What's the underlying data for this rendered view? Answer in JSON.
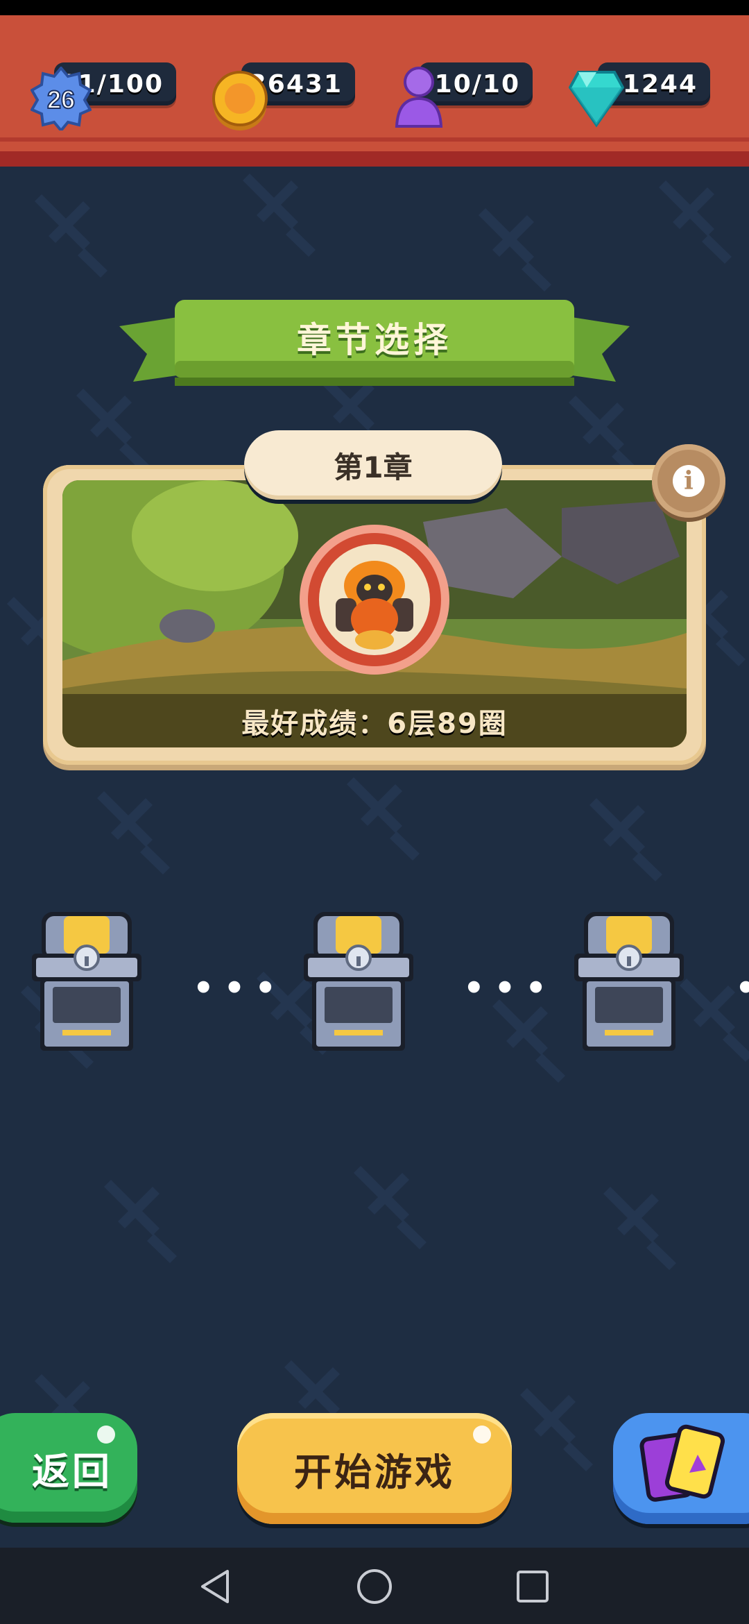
{
  "resources": {
    "level": "26",
    "xp": "81/100",
    "coins": "36431",
    "energy": "10/10",
    "gems": "1244"
  },
  "title_ribbon": "章节选择",
  "chapter": {
    "name": "第1章",
    "best_score": "最好成绩：6层89圈"
  },
  "icons": {
    "level": "level-badge-icon",
    "coin": "coin-icon",
    "energy": "energy-pawn-icon",
    "gem": "gem-icon",
    "info": "info-icon",
    "boss": "lava-golem-boss-icon",
    "chest": "locked-chest-icon",
    "cards": "card-deck-icon"
  },
  "chests": [
    {
      "state": "locked"
    },
    {
      "state": "locked"
    },
    {
      "state": "locked"
    }
  ],
  "buttons": {
    "back": "返回",
    "start": "开始游戏"
  },
  "colors": {
    "top_bar": "#c9503a",
    "background": "#1e2d42",
    "ribbon_green": "#7db73a",
    "start_button": "#f7c34c",
    "back_button": "#33b25a",
    "card_button": "#4c94ef"
  }
}
